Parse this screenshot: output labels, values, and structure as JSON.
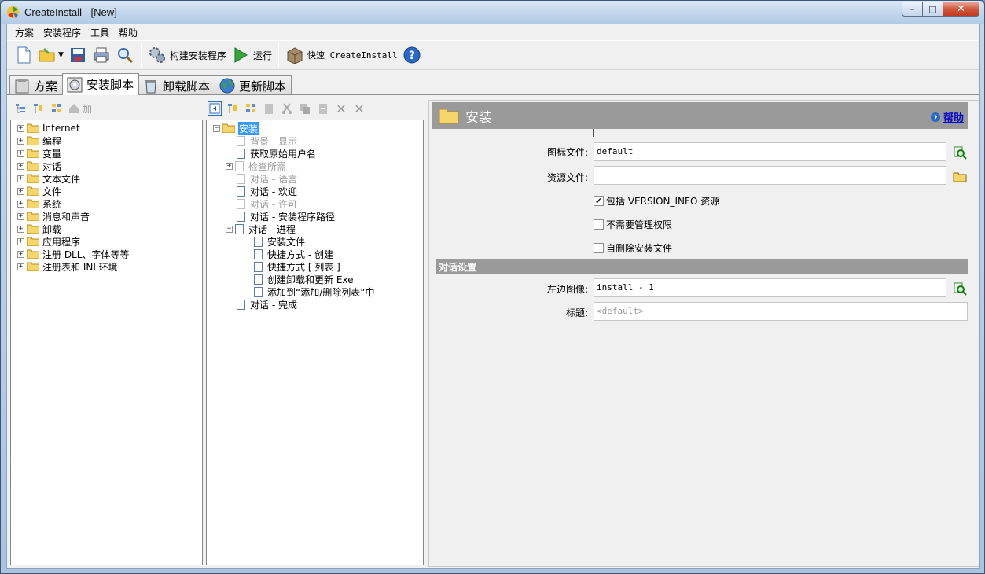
{
  "window": {
    "title": "CreateInstall - [New]"
  },
  "menu": [
    "方案",
    "安装程序",
    "工具",
    "帮助"
  ],
  "toolbar": {
    "build_label": "构建安装程序",
    "run_label": "运行",
    "quick_label": "快速 CreateInstall"
  },
  "tabs": [
    "方案",
    "安装脚本",
    "卸载脚本",
    "更新脚本"
  ],
  "left_toolbar": {
    "add_label": "加"
  },
  "left_tree": [
    "Internet",
    "编程",
    "变量",
    "对话",
    "文本文件",
    "文件",
    "系统",
    "消息和声音",
    "卸载",
    "应用程序",
    "注册 DLL、字体等等",
    "注册表和 INI 环境"
  ],
  "script_tree": {
    "root": "安装",
    "items": [
      {
        "label": "背景 - 显示",
        "disabled": true
      },
      {
        "label": "获取原始用户名",
        "disabled": false
      },
      {
        "label": "检查所需",
        "disabled": true
      },
      {
        "label": "对话 - 语言",
        "disabled": true
      },
      {
        "label": "对话 - 欢迎",
        "disabled": false
      },
      {
        "label": "对话 - 许可",
        "disabled": true
      },
      {
        "label": "对话 - 安装程序路径",
        "disabled": false
      },
      {
        "label": "对话 - 进程",
        "disabled": false
      },
      {
        "label": "安装文件",
        "disabled": false
      },
      {
        "label": "快捷方式 - 创建",
        "disabled": false
      },
      {
        "label": "快捷方式 [ 列表 ]",
        "disabled": false
      },
      {
        "label": "创建卸载和更新 Exe",
        "disabled": false
      },
      {
        "label": "添加到“添加/删除列表”中",
        "disabled": false
      },
      {
        "label": "对话 - 完成",
        "disabled": false
      }
    ]
  },
  "properties": {
    "header": "安装",
    "help_label": "帮助",
    "icon_file_label": "图标文件:",
    "icon_file_value": "default",
    "resource_file_label": "资源文件:",
    "resource_file_value": "",
    "chk_version_info": {
      "label": "包括 VERSION_INFO 资源",
      "checked": true
    },
    "chk_no_admin": {
      "label": "不需要管理权限",
      "checked": false
    },
    "chk_self_delete": {
      "label": "自删除安装文件",
      "checked": false
    },
    "dialog_section": "对话设置",
    "left_image_label": "左边图像:",
    "left_image_value": "install - 1",
    "caption_label": "标题:",
    "caption_placeholder": "<default>"
  },
  "colors": {
    "selection": "#3399ff",
    "header_gray": "#9a9a9a",
    "link": "#0000cc",
    "close_red": "#c23a1f"
  }
}
